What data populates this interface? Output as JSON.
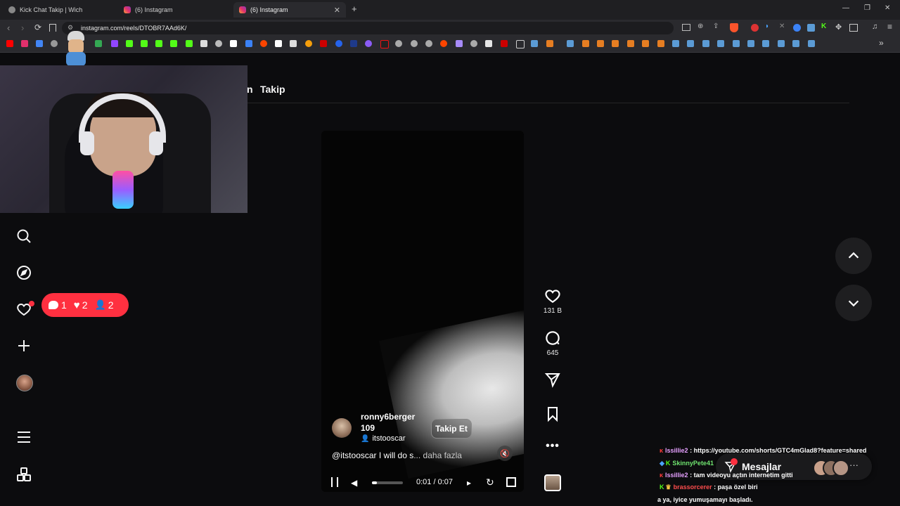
{
  "browser": {
    "tabs": [
      {
        "label": "Kick Chat Takip | Wich"
      },
      {
        "label": "(6) Instagram"
      },
      {
        "label": "(6) Instagram"
      }
    ],
    "new_tab": "+",
    "url": "instagram.com/reels/DTOBR7AAd6K/",
    "window_controls": {
      "minimize": "—",
      "maximize": "❐",
      "close": "✕"
    }
  },
  "header": {
    "following_tab": "Takip",
    "partial_prefix": "n"
  },
  "notifications_badge": {
    "comments": "1",
    "likes": "2",
    "follows": "2"
  },
  "reel": {
    "username": "ronny6berger",
    "sub_line": "109",
    "follow_button": "Takip Et",
    "audio_credit": "itstooscar",
    "caption": "@itstooscar I will do s",
    "caption_more": "... daha fazla",
    "time_current": "0:01",
    "time_sep": "/",
    "time_total": "0:07",
    "progress": 0.15
  },
  "actions": {
    "likes_count": "131 B",
    "comments_count": "645"
  },
  "messages": {
    "label": "Mesajlar",
    "more": "···"
  },
  "chat": [
    {
      "user": "lssillie2",
      "text": ": https://youtube.com/shorts/GTC4mGlad8?feature=shared",
      "color": "#e6a0ff"
    },
    {
      "user": "SkinnyPete41",
      "text": "",
      "color": "#6fe36f"
    },
    {
      "user": "lssillie2",
      "text": ": tam videoyu açtın internetim gitti",
      "color": "#e6a0ff"
    },
    {
      "user": "brassorcerer",
      "text": ": paşa özel biri",
      "color": "#ff4d4d"
    },
    {
      "user": "",
      "text": "a ya, iyice yumuşamayı başladı.",
      "color": "#ffffff"
    }
  ],
  "colors": {
    "badge_red": "#ff3040",
    "bg": "#0c0c0e"
  }
}
